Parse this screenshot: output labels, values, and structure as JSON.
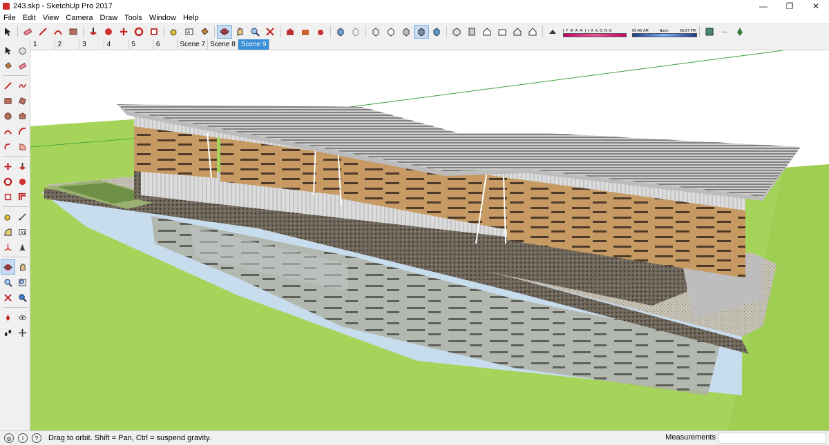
{
  "window": {
    "title": "243.skp - SketchUp Pro 2017",
    "controls": {
      "minimize": "—",
      "maximize": "❐",
      "close": "✕"
    }
  },
  "menu": [
    "File",
    "Edit",
    "View",
    "Camera",
    "Draw",
    "Tools",
    "Window",
    "Help"
  ],
  "shadow_settings": {
    "months": [
      "J",
      "F",
      "M",
      "A",
      "M",
      "J",
      "J",
      "A",
      "S",
      "O",
      "N",
      "D"
    ],
    "time_start": "05:45 AM",
    "time_mid": "Noon",
    "time_end": "06:07 PM"
  },
  "scenes": {
    "tabs": [
      "1",
      "2",
      "3",
      "4",
      "5",
      "6",
      "Scene 7",
      "Scene 8",
      "Scene 9"
    ],
    "active": "Scene 9"
  },
  "status": {
    "hint": "Drag to orbit. Shift = Pan, Ctrl = suspend gravity.",
    "measurements_label": "Measurements",
    "measurements_value": ""
  },
  "colors": {
    "accent": "#3a8fd8",
    "grass": "#a7d65a",
    "water": "#c9dff0",
    "facade_wood": "#c79a5f",
    "roof": "#b8b8b8"
  }
}
